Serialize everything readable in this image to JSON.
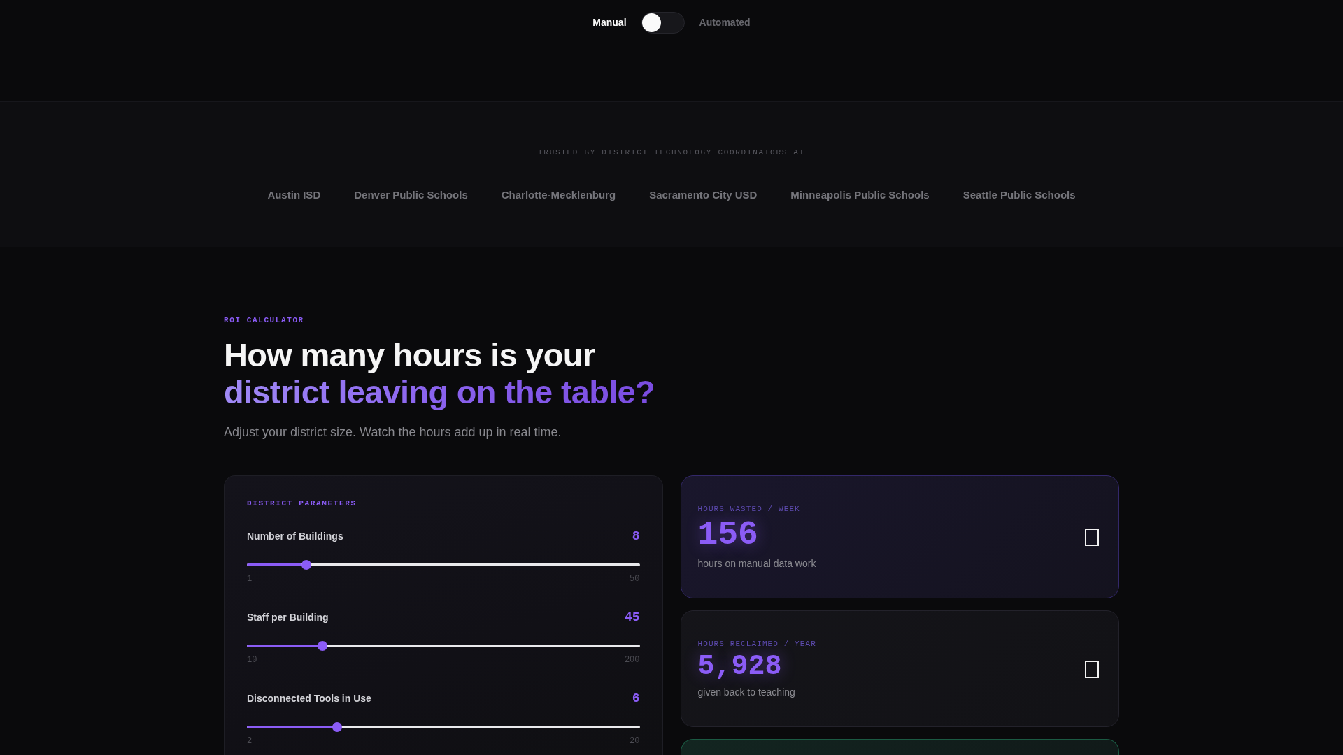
{
  "mode_toggle": {
    "options": [
      {
        "label": "Manual",
        "selected": true
      },
      {
        "label": "Automated",
        "selected": false
      }
    ]
  },
  "trusted_by": {
    "caption": "TRUSTED BY DISTRICT TECHNOLOGY COORDINATORS AT",
    "districts": [
      "Austin ISD",
      "Denver Public Schools",
      "Charlotte-Mecklenburg",
      "Sacramento City USD",
      "Minneapolis Public Schools",
      "Seattle Public Schools"
    ]
  },
  "roi_calculator": {
    "eyebrow": "ROI CALCULATOR",
    "heading": "How many hours is your",
    "heading_highlight": "district leaving on the table?",
    "subtitle": "Adjust your district size. Watch the hours add up in real time.",
    "parameters_panel": {
      "title": "DISTRICT PARAMETERS",
      "parameters": [
        {
          "label": "Number of Buildings",
          "value": "8",
          "level": 0.143,
          "min": "1",
          "max": "50"
        },
        {
          "label": "Staff per Building",
          "value": "45",
          "level": 0.184,
          "min": "10",
          "max": "200"
        },
        {
          "label": "Disconnected Tools in Use",
          "value": "6",
          "level": 0.222,
          "min": "2",
          "max": "20"
        }
      ]
    },
    "metrics": [
      {
        "label": "HOURS WASTED / WEEK",
        "value": "156",
        "caption": "hours on manual data work",
        "highlighted": true,
        "color": "#33286a"
      },
      {
        "label": "HOURS RECLAIMED / YEAR",
        "value": "5,928",
        "caption": "given back to teaching",
        "highlighted": false,
        "color": "#23222b"
      },
      {
        "color": "#1b5a43"
      }
    ]
  }
}
